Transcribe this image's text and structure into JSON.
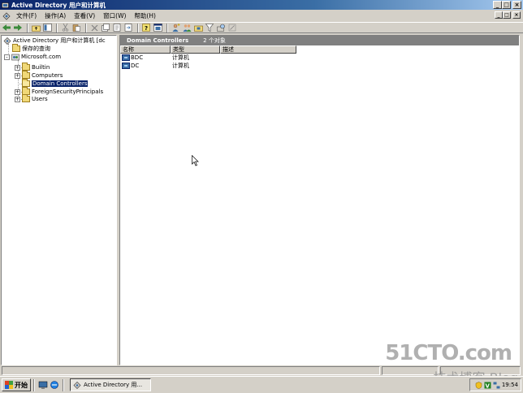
{
  "window": {
    "title": "Active Directory 用户和计算机",
    "minimize": "_",
    "maximize": "□",
    "close": "×"
  },
  "menubar": {
    "items": [
      "文件(F)",
      "操作(A)",
      "查看(V)",
      "窗口(W)",
      "帮助(H)"
    ]
  },
  "tree": {
    "root": "Active Directory 用户和计算机 [dc",
    "saved_queries": "保存的查询",
    "domain": "Microsoft.com",
    "children": [
      "Builtin",
      "Computers",
      "Domain Controllers",
      "ForeignSecurityPrincipals",
      "Users"
    ],
    "expander_plus": "+",
    "expander_minus": "-"
  },
  "details": {
    "header_title": "Domain Controllers",
    "header_count": "2 个对象",
    "columns": [
      "名称",
      "类型",
      "描述"
    ],
    "rows": [
      {
        "name": "BDC",
        "type": "计算机",
        "desc": ""
      },
      {
        "name": "DC",
        "type": "计算机",
        "desc": ""
      }
    ]
  },
  "taskbar": {
    "start_label": "开始",
    "task_label": "Active Directory 用...",
    "clock": "19:54"
  },
  "watermark": {
    "line1": "51CTO.com",
    "line2": "技术博客 Blog"
  },
  "colors": {
    "title_start": "#0a246a",
    "title_end": "#a6caf0",
    "selection": "#0a246a",
    "face": "#d4d0c8"
  }
}
